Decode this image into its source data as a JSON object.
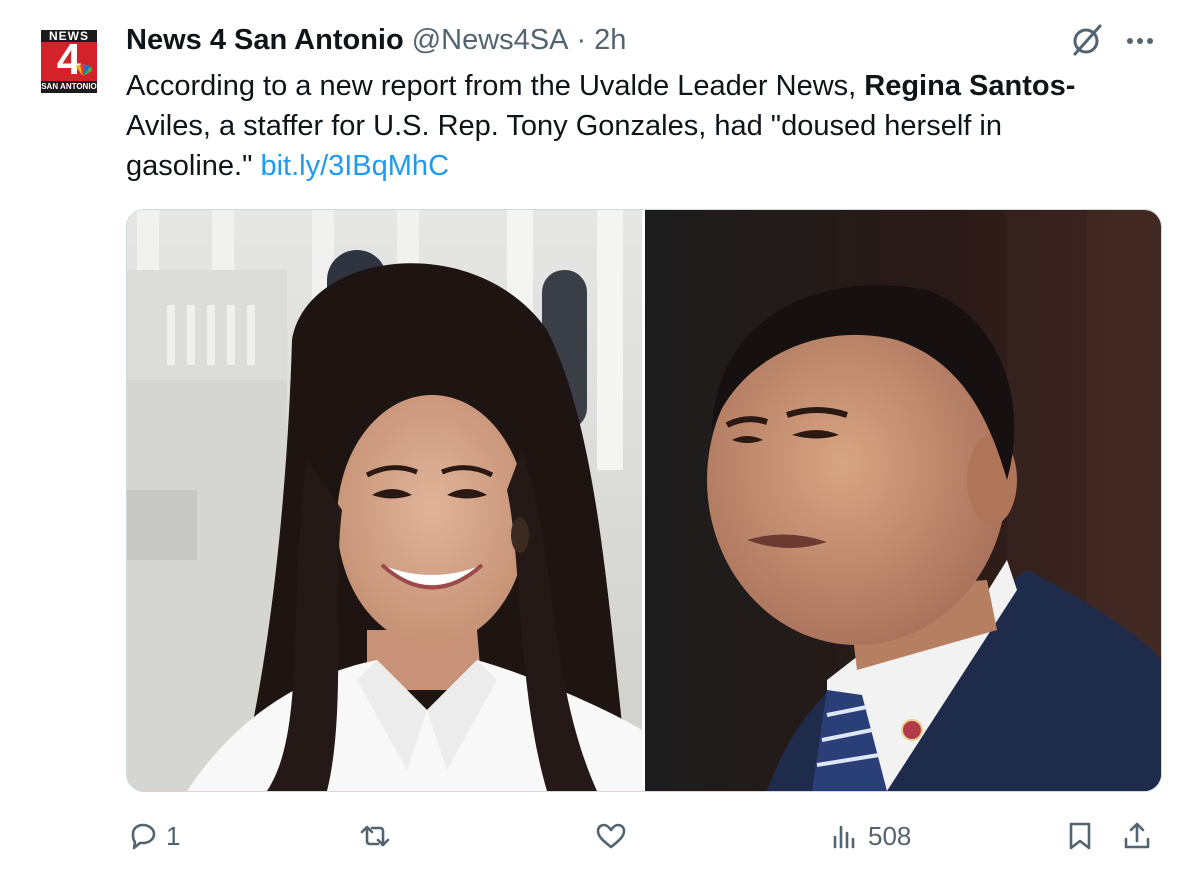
{
  "account": {
    "avatar_logo": {
      "top": "NEWS",
      "number": "4",
      "bottom": "SAN ANTONIO"
    },
    "name": "News 4 San Antonio",
    "handle": "@News4SA",
    "separator": "·",
    "time": "2h"
  },
  "tweet": {
    "text_1": "According to a new report from the Uvalde Leader News, ",
    "bold_name": "Regina Santos-",
    "text_2": "Aviles, a staffer for U.S. Rep. Tony Gonzales, had \"doused herself in gasoline.\" ",
    "link": "bit.ly/3IBqMhC"
  },
  "actions": {
    "reply_count": "1",
    "repost_count": "",
    "like_count": "",
    "views_count": "508"
  },
  "icons": [
    "grok-icon",
    "more-icon",
    "reply-icon",
    "repost-icon",
    "like-icon",
    "views-icon",
    "bookmark-icon",
    "share-icon"
  ],
  "colors": {
    "link": "#1d9bf0",
    "secondary_text": "#536471",
    "brand_red": "#d3222a"
  }
}
